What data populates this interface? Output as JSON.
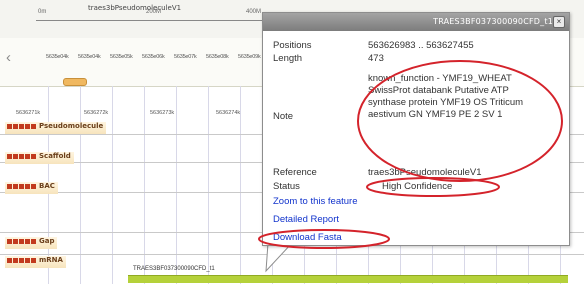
{
  "overview": {
    "title": "traes3bPseudomoleculeV1",
    "start_label": "0m",
    "mid_label": "200M",
    "end_label": "400M"
  },
  "ruler": {
    "ticks": [
      "5635e04k",
      "5635e04k",
      "5635e05k",
      "5635e06k",
      "5635e07k",
      "5635e08k",
      "5635e09k"
    ],
    "pseudo_ticks": [
      "5636271k",
      "5636272k",
      "5636273k",
      "5636274k"
    ]
  },
  "tracks": [
    {
      "label": "Pseudomolecule"
    },
    {
      "label": "Scaffold"
    },
    {
      "label": "BAC"
    },
    {
      "label": "Gap"
    },
    {
      "label": "mRNA"
    }
  ],
  "feature_label": "TRAES3BF037300090CFD_t1",
  "popup": {
    "title": "TRAES3BF037300090CFD_t1",
    "close_glyph": "×",
    "fields": {
      "positions_label": "Positions",
      "positions_value": "563626983 .. 563627455",
      "length_label": "Length",
      "length_value": "473",
      "note_label": "Note",
      "note_value": "known_function - YMF19_WHEAT SwissProt databank Putative ATP synthase protein YMF19 OS Triticum aestivum GN YMF19 PE 2 SV 1",
      "reference_label": "Reference",
      "reference_value": "traes3bPseudomoleculeV1",
      "status_label": "Status",
      "status_value": "High Confidence"
    },
    "links": {
      "zoom": "Zoom to this feature",
      "report": "Detailed Report",
      "download": "Download Fasta"
    }
  },
  "colors": {
    "annotation": "#d4232b",
    "link": "#1133cc",
    "feature": "#b5d13a"
  }
}
